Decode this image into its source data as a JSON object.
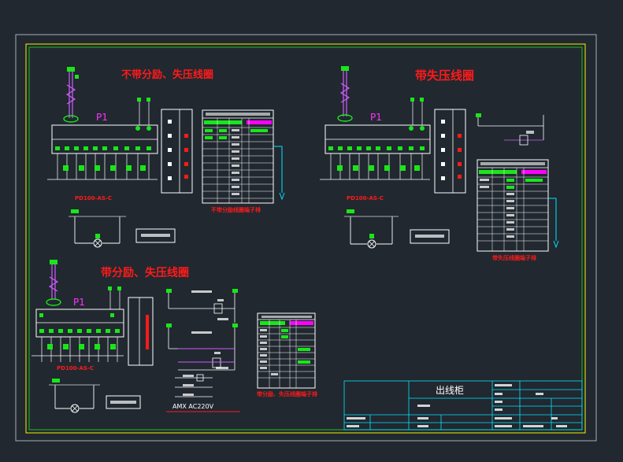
{
  "colors": {
    "background": "#212830",
    "white": "#ffffff",
    "yellow": "#f2f200",
    "cyan": "#00e5ff",
    "red": "#ff1a1a",
    "green": "#19e619",
    "magenta": "#ff00ff",
    "gray": "#a9aeb4"
  },
  "titles": {
    "top_left": "不带分励、失压线圈",
    "top_right": "带失压线圈",
    "bottom_left": "带分励、失压线圈"
  },
  "labels": {
    "p1_a": "P1",
    "p1_b": "P1",
    "p1_c": "P1",
    "device_caption_a": "PD100-AS-C",
    "device_caption_b": "PD100-AS-C",
    "terminal_caption_a": "不带分励线圈端子排",
    "terminal_caption_b": "带失压线圈端子排",
    "terminal_caption_c": "带分励、失压线圈端子排",
    "ac_note": "AMX  AC220V",
    "title_block_name": "出线柜"
  }
}
